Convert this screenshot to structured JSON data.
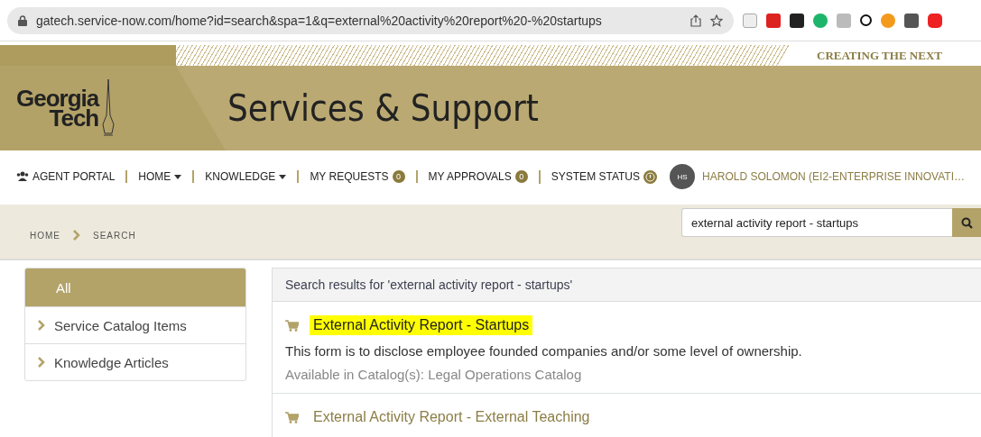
{
  "browser": {
    "url": "gatech.service-now.com/home?id=search&spa=1&q=external%20activity%20report%20-%20startups"
  },
  "banner": {
    "tagline": "CREATING THE NEXT",
    "logo_line_1": "Georgia",
    "logo_line_2": "Tech",
    "title": "Services & Support"
  },
  "nav": {
    "items": [
      {
        "kind": "icon",
        "label": "AGENT PORTAL"
      },
      {
        "kind": "dropdown",
        "label": "HOME"
      },
      {
        "kind": "dropdown",
        "label": "KNOWLEDGE"
      },
      {
        "kind": "badge",
        "label": "MY REQUESTS",
        "badge": "0"
      },
      {
        "kind": "badge",
        "label": "MY APPROVALS",
        "badge": "0"
      },
      {
        "kind": "status",
        "label": "SYSTEM STATUS"
      }
    ],
    "user": {
      "initials": "HS",
      "name": "HAROLD SOLOMON (EI2-ENTERPRISE INNOVATI…"
    }
  },
  "breadcrumbs": [
    "HOME",
    "SEARCH"
  ],
  "search": {
    "value": "external activity report - startups"
  },
  "filters": [
    {
      "label": "All",
      "selected": true
    },
    {
      "label": "Service Catalog Items",
      "selected": false
    },
    {
      "label": "Knowledge Articles",
      "selected": false
    }
  ],
  "results": {
    "heading": "Search results for 'external activity report - startups'",
    "items": [
      {
        "title": "External Activity Report - Startups",
        "highlighted": true,
        "description": "This form is to disclose employee founded companies and/or some level of ownership.",
        "catalog": "Available in Catalog(s): Legal Operations Catalog"
      },
      {
        "title": "External Activity Report - External Teaching",
        "highlighted": false
      }
    ]
  }
}
